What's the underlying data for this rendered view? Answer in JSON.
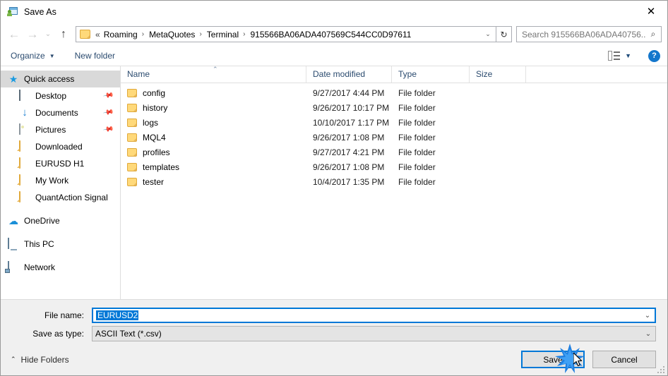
{
  "window": {
    "title": "Save As",
    "close_label": "✕",
    "app_icon": "save-as-icon"
  },
  "nav": {
    "back_label": "←",
    "forward_label": "→",
    "recent_label": "⌄",
    "up_label": "↑",
    "refresh_label": "↻",
    "dropdown_label": "⌄",
    "breadcrumb_lead": "«",
    "separator": "›",
    "crumbs": [
      {
        "label": "Roaming"
      },
      {
        "label": "MetaQuotes"
      },
      {
        "label": "Terminal"
      },
      {
        "label": "915566BA06ADA407569C544CC0D97611"
      }
    ]
  },
  "search": {
    "placeholder": "Search 915566BA06ADA40756...",
    "icon": "search-icon"
  },
  "toolbar": {
    "organize_label": "Organize",
    "organize_caret": "▼",
    "new_folder_label": "New folder",
    "view_caret": "▼",
    "help_label": "?"
  },
  "sidebar": {
    "items": [
      {
        "label": "Quick access",
        "icon": "star-icon",
        "selected": true,
        "pinned": false,
        "indent": false
      },
      {
        "label": "Desktop",
        "icon": "desktop-icon",
        "selected": false,
        "pinned": true,
        "indent": true
      },
      {
        "label": "Documents",
        "icon": "documents-icon",
        "selected": false,
        "pinned": true,
        "indent": true
      },
      {
        "label": "Pictures",
        "icon": "pictures-icon",
        "selected": false,
        "pinned": true,
        "indent": true
      },
      {
        "label": "Downloaded",
        "icon": "folder-icon",
        "selected": false,
        "pinned": false,
        "indent": true
      },
      {
        "label": "EURUSD H1",
        "icon": "folder-icon",
        "selected": false,
        "pinned": false,
        "indent": true
      },
      {
        "label": "My Work",
        "icon": "folder-icon",
        "selected": false,
        "pinned": false,
        "indent": true
      },
      {
        "label": "QuantAction Signal",
        "icon": "folder-icon",
        "selected": false,
        "pinned": false,
        "indent": true
      },
      {
        "label": "OneDrive",
        "icon": "onedrive-icon",
        "selected": false,
        "pinned": false,
        "indent": false,
        "gap_before": true
      },
      {
        "label": "This PC",
        "icon": "this-pc-icon",
        "selected": false,
        "pinned": false,
        "indent": false,
        "gap_before": true
      },
      {
        "label": "Network",
        "icon": "network-icon",
        "selected": false,
        "pinned": false,
        "indent": false,
        "gap_before": true
      }
    ]
  },
  "filelist": {
    "columns": [
      "Name",
      "Date modified",
      "Type",
      "Size"
    ],
    "sort_indicator": "⌃",
    "rows": [
      {
        "name": "config",
        "date": "9/27/2017 4:44 PM",
        "type": "File folder",
        "size": ""
      },
      {
        "name": "history",
        "date": "9/26/2017 10:17 PM",
        "type": "File folder",
        "size": ""
      },
      {
        "name": "logs",
        "date": "10/10/2017 1:17 PM",
        "type": "File folder",
        "size": ""
      },
      {
        "name": "MQL4",
        "date": "9/26/2017 1:08 PM",
        "type": "File folder",
        "size": ""
      },
      {
        "name": "profiles",
        "date": "9/27/2017 4:21 PM",
        "type": "File folder",
        "size": ""
      },
      {
        "name": "templates",
        "date": "9/26/2017 1:08 PM",
        "type": "File folder",
        "size": ""
      },
      {
        "name": "tester",
        "date": "10/4/2017 1:35 PM",
        "type": "File folder",
        "size": ""
      }
    ]
  },
  "form": {
    "filename_label": "File name:",
    "filename_value": "EURUSD2",
    "filetype_label": "Save as type:",
    "filetype_value": "ASCII Text (*.csv)",
    "chevron": "⌄"
  },
  "footer": {
    "hide_folders_label": "Hide Folders",
    "hide_folders_caret": "⌃",
    "save_label": "Save",
    "cancel_label": "Cancel"
  },
  "colors": {
    "accent": "#0078d7",
    "selection": "#0078d7",
    "sidebar_selected": "#d9d9d9",
    "folder": "#ffd97a",
    "header_text": "#2b4b6f",
    "panel": "#f0f0f0",
    "help_blue": "#1477cc"
  }
}
